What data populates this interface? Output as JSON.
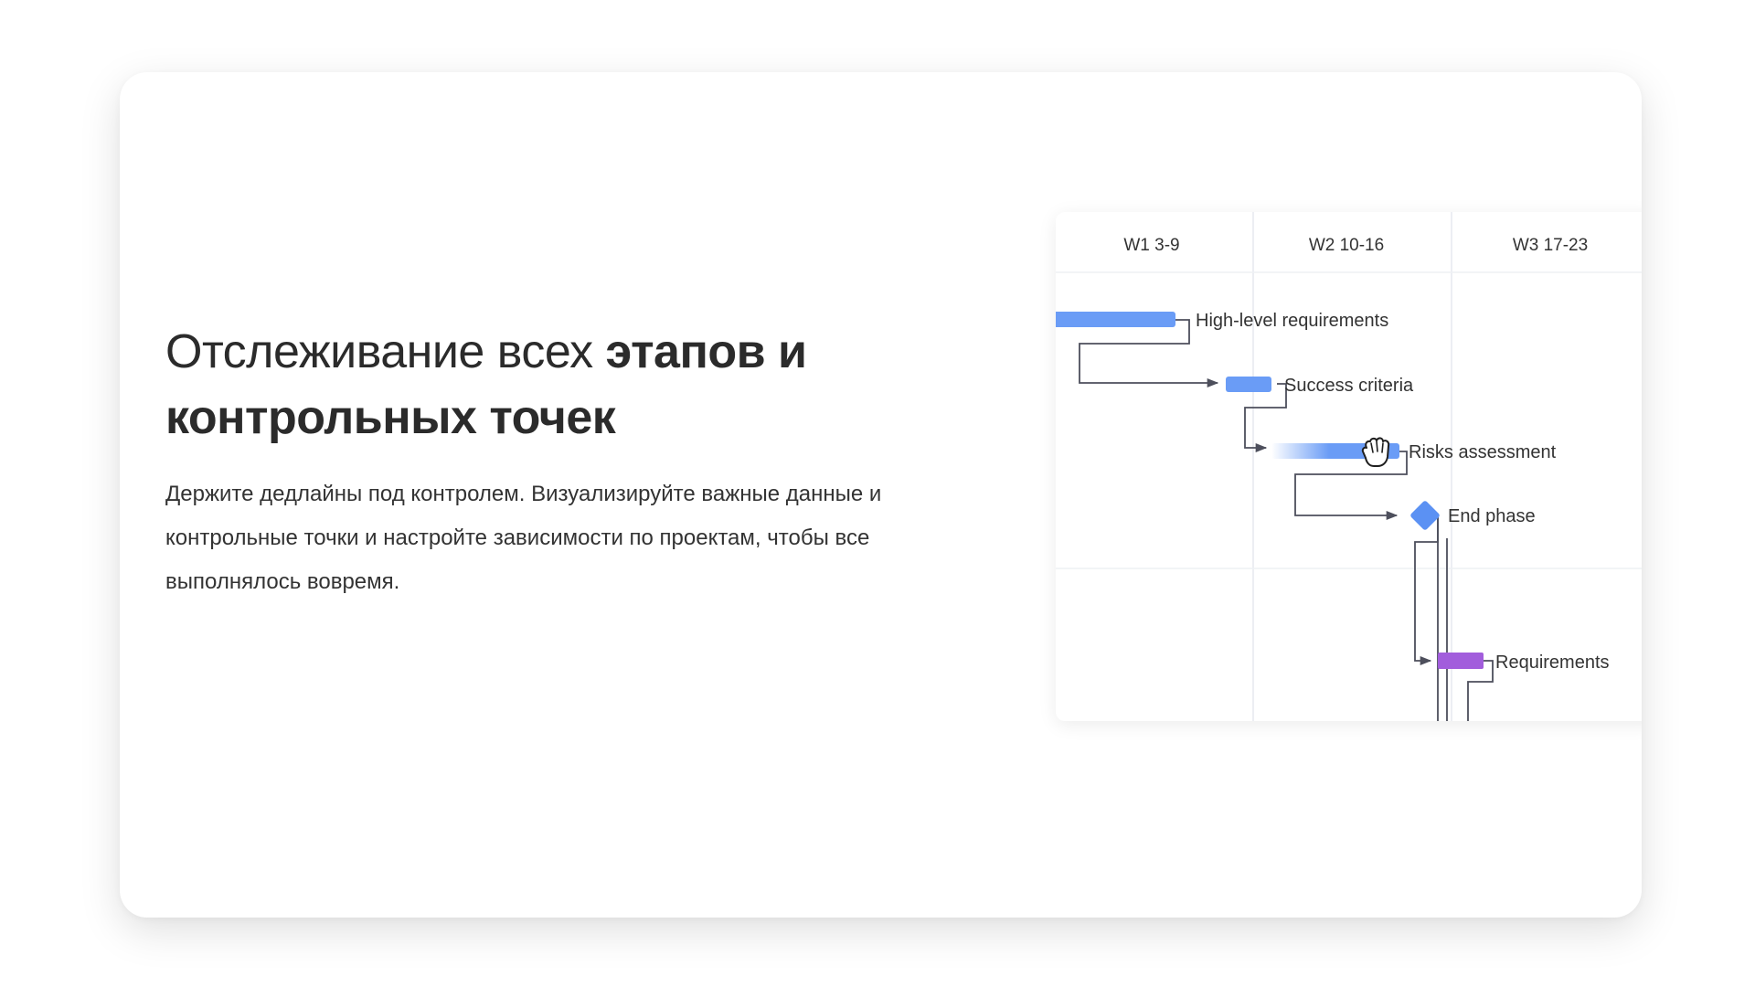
{
  "headline": {
    "light": "Отслеживание всех ",
    "bold_1": "этапов и",
    "bold_2": "контрольных точек"
  },
  "description": "Держите дедлайны под контролем. Визуализируйте важные данные и контрольные точки и настройте зависимости по проектам, чтобы все выполнялось вовремя.",
  "gantt": {
    "columns": [
      "W1 3-9",
      "W2 10-16",
      "W3 17-23"
    ],
    "tasks": [
      {
        "label": "High-level requirements",
        "type": "bar",
        "color": "#6a9cf6"
      },
      {
        "label": "Success criteria",
        "type": "bar",
        "color": "#6a9cf6"
      },
      {
        "label": "Risks assessment",
        "type": "bar-fading",
        "color": "#6a9cf6"
      },
      {
        "label": "End phase",
        "type": "milestone",
        "color": "#5b91f3"
      },
      {
        "label": "Requirements",
        "type": "bar",
        "color": "#a25ddc"
      }
    ],
    "cursor_icon": "hand-grab-cursor",
    "line_color": "#4d4f5c",
    "grid_color": "#e6e9ef"
  }
}
